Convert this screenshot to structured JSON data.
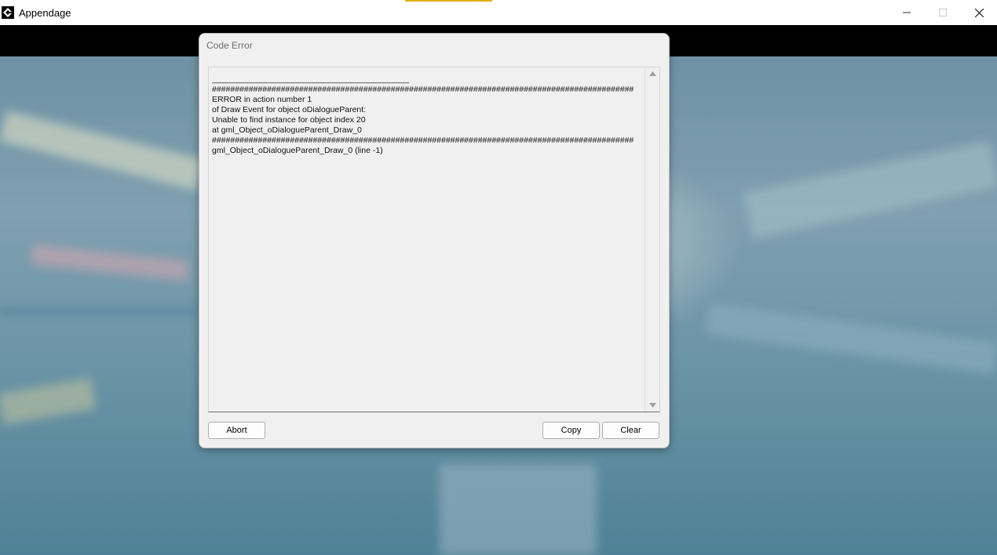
{
  "window": {
    "title": "Appendage",
    "icon": "game-maker-icon",
    "controls": [
      "minimize-icon",
      "maximize-icon",
      "close-icon"
    ]
  },
  "dialog": {
    "title": "Code Error",
    "log_lines": [
      "___________________________________________",
      "############################################################################################",
      "ERROR in action number 1",
      "of Draw Event for object oDialogueParent:",
      "Unable to find instance for object index 20",
      "at gml_Object_oDialogueParent_Draw_0",
      "############################################################################################",
      "gml_Object_oDialogueParent_Draw_0 (line -1)"
    ],
    "buttons": {
      "abort": "Abort",
      "copy": "Copy",
      "clear": "Clear"
    }
  },
  "colors": {
    "title_accent": "#e0b000",
    "dialog_bg": "#f0f0f0",
    "background_tint": "#5f8ea3"
  }
}
